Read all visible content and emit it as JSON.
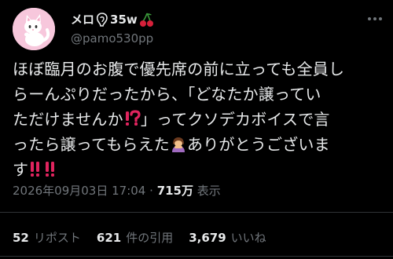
{
  "author": {
    "display_name": "メロ",
    "display_name_suffix": "35w",
    "handle": "@pamo530pp",
    "avatar_icon": "white-cat-avatar-icon",
    "name_emojis": [
      "ear-icon",
      "cherries-icon"
    ]
  },
  "tweet": {
    "lines": [
      "ほぼ臨月のお腹で優先席の前に立っても全員し",
      "らーんぷりだったから、「どなたか譲ってい",
      "ただけませんか",
      "」ってクソデカボイスで言",
      "ったら譲ってもらえた",
      "ありがとうございま",
      "す"
    ],
    "emojis": [
      "exclamation-question-icon",
      "woman-bowing-icon",
      "double-exclamation-icon"
    ]
  },
  "meta": {
    "timestamp": "2026年09月03日 17:04",
    "separator": "·",
    "views": "715万",
    "views_label": "表示"
  },
  "stats": {
    "retweets": "52",
    "retweets_label": "リポスト",
    "quotes": "621",
    "quotes_label": "件の引用",
    "likes": "3,679",
    "likes_label": "いいね"
  },
  "colors": {
    "background": "#000000",
    "text": "#e7e9ea",
    "muted": "#71767b",
    "divider": "#2f3336",
    "emoji_red": "#e0245e"
  }
}
